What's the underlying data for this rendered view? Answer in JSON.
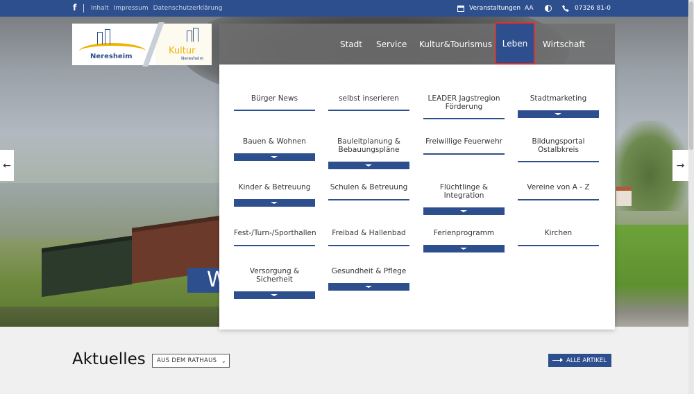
{
  "topbar": {
    "facebook_label": "f",
    "links": [
      "Inhalt",
      "Impressum",
      "Datenschutzerklärung"
    ],
    "events_label": "Veranstaltungen",
    "font_size_label": "AA",
    "phone": "07326 81-0"
  },
  "logo": {
    "neresheim": "Neresheim",
    "kultur": "Kultur",
    "kultur_sub": "Neresheim"
  },
  "nav": {
    "items": [
      "Stadt",
      "Service",
      "Kultur&Tourismus",
      "Leben",
      "Wirtschaft"
    ],
    "active": "Leben"
  },
  "hero": {
    "partial_text": "W"
  },
  "dropdown": {
    "items": [
      {
        "label": "Bürger News",
        "expandable": false
      },
      {
        "label": "selbst inserieren",
        "expandable": false
      },
      {
        "label": "LEADER Jagstregion Förderung",
        "expandable": false
      },
      {
        "label": "Stadtmarketing",
        "expandable": true
      },
      {
        "label": "Bauen & Wohnen",
        "expandable": true
      },
      {
        "label": "Bauleitplanung & Bebauungspläne",
        "expandable": true
      },
      {
        "label": "Freiwillige Feuerwehr",
        "expandable": false
      },
      {
        "label": "Bildungsportal Ostalbkreis",
        "expandable": false
      },
      {
        "label": "Kinder & Betreuung",
        "expandable": true
      },
      {
        "label": "Schulen & Betreuung",
        "expandable": false
      },
      {
        "label": "Flüchtlinge & Integration",
        "expandable": true
      },
      {
        "label": "Vereine von A - Z",
        "expandable": false
      },
      {
        "label": "Fest-/Turn-/Sporthallen",
        "expandable": false
      },
      {
        "label": "Freibad & Hallenbad",
        "expandable": false
      },
      {
        "label": "Ferienprogramm",
        "expandable": true
      },
      {
        "label": "Kirchen",
        "expandable": false
      },
      {
        "label": "Versorgung & Sicherheit",
        "expandable": true
      },
      {
        "label": "Gesundheit & Pflege",
        "expandable": true
      }
    ]
  },
  "news": {
    "title": "Aktuelles",
    "filter_value": "AUS DEM RATHAUS",
    "all_articles_label": "ALLE ARTIKEL"
  },
  "colors": {
    "brand_blue": "#2e4f8e",
    "highlight_red": "#e03030",
    "logo_yellow": "#f0b400"
  }
}
